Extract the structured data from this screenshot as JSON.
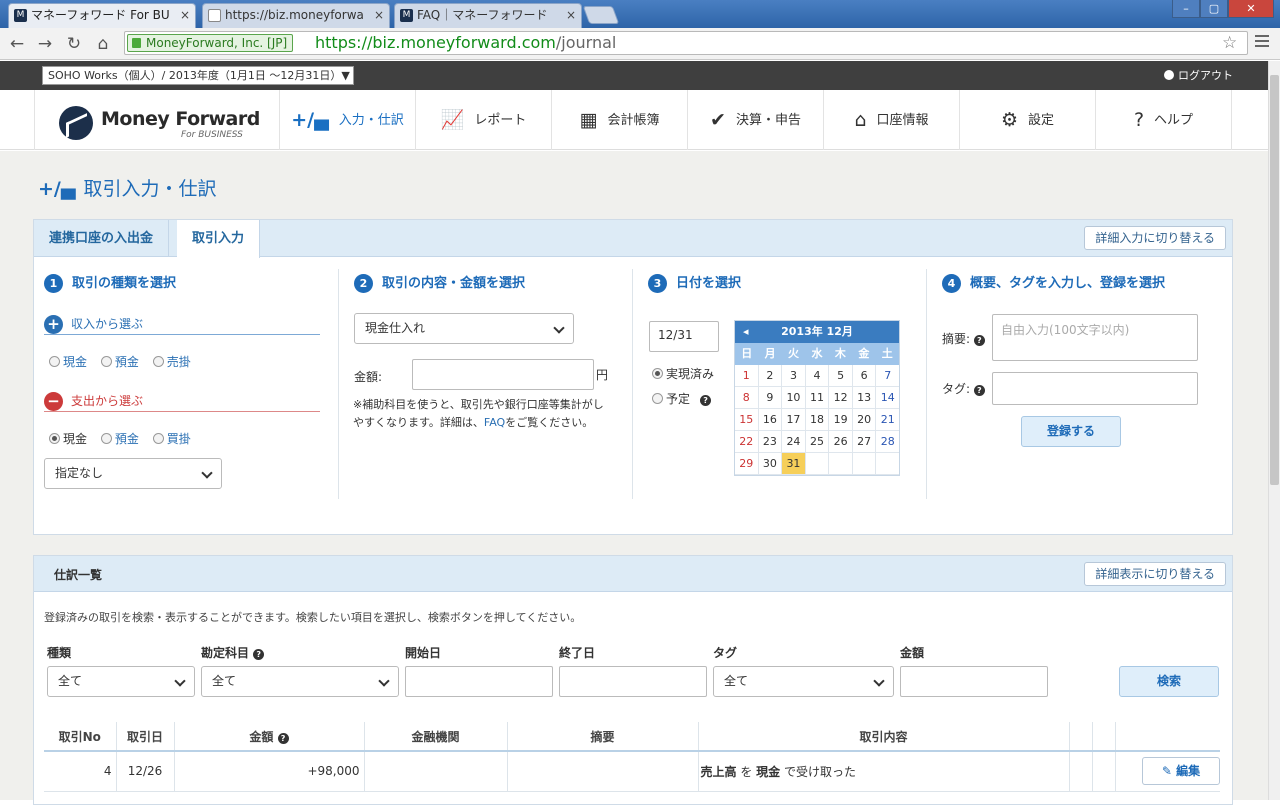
{
  "browser": {
    "tabs": [
      {
        "title": "マネーフォワード For BU",
        "close": "×",
        "favicon": "M"
      },
      {
        "title": "https://biz.moneyforwa",
        "close": "×",
        "favicon": ""
      },
      {
        "title": "FAQ｜マネーフォワード",
        "close": "×",
        "favicon": "M"
      }
    ],
    "window_buttons": [
      "–",
      "▢",
      "✕"
    ],
    "security_badge": "MoneyForward, Inc. [JP]",
    "url_scheme_host": "https://biz.moneyforward.com",
    "url_path": "/journal"
  },
  "topbar": {
    "office_select": "SOHO Works（個人）/  2013年度（1月1日 ～12月31日）▼",
    "logout": "ログアウト"
  },
  "logo": {
    "name": "Money Forward",
    "sub": "For BUSINESS"
  },
  "nav": [
    {
      "icon": "+/▄",
      "label": "入力・仕訳"
    },
    {
      "icon": "📈",
      "label": "レポート"
    },
    {
      "icon": "▦",
      "label": "会計帳簿"
    },
    {
      "icon": "✔",
      "label": "決算・申告"
    },
    {
      "icon": "⌂",
      "label": "口座情報"
    },
    {
      "icon": "⚙",
      "label": "設定"
    },
    {
      "icon": "?",
      "label": "ヘルプ"
    }
  ],
  "page": {
    "title_icon": "+/▄",
    "title": "取引入力・仕訳"
  },
  "entry": {
    "tabs": [
      "連携口座の入出金",
      "取引入力"
    ],
    "switch_label": "詳細入力に切り替える",
    "step1": {
      "num": "1",
      "title": "取引の種類を選択",
      "income_label": "収入から選ぶ",
      "income_options": [
        "現金",
        "預金",
        "売掛"
      ],
      "expense_label": "支出から選ぶ",
      "expense_options": [
        "現金",
        "預金",
        "買掛"
      ],
      "sub_select": "指定なし"
    },
    "step2": {
      "num": "2",
      "title": "取引の内容・金額を選択",
      "content_select": "現金仕入れ",
      "amount_label": "金額:",
      "amount_unit": "円",
      "note_text": "※補助科目を使うと、取引先や銀行口座等集計がしやすくなります。詳細は、",
      "note_link": "FAQ",
      "note_tail": "をご覧ください。"
    },
    "step3": {
      "num": "3",
      "title": "日付を選択",
      "date_value": "12/31",
      "status_options": [
        "実現済み",
        "予定"
      ],
      "calendar": {
        "prev": "◂",
        "month_label": "2013年 12月",
        "dow": [
          "日",
          "月",
          "火",
          "水",
          "木",
          "金",
          "土"
        ],
        "weeks": [
          [
            "1",
            "2",
            "3",
            "4",
            "5",
            "6",
            "7"
          ],
          [
            "8",
            "9",
            "10",
            "11",
            "12",
            "13",
            "14"
          ],
          [
            "15",
            "16",
            "17",
            "18",
            "19",
            "20",
            "21"
          ],
          [
            "22",
            "23",
            "24",
            "25",
            "26",
            "27",
            "28"
          ],
          [
            "29",
            "30",
            "31",
            "",
            "",
            "",
            ""
          ]
        ],
        "selected": "31"
      }
    },
    "step4": {
      "num": "4",
      "title": "概要、タグを入力し、登録を選択",
      "summary_label": "摘要:",
      "summary_placeholder": "自由入力(100文字以内)",
      "tag_label": "タグ:",
      "register": "登録する"
    }
  },
  "list": {
    "title": "仕訳一覧",
    "switch_label": "詳細表示に切り替える",
    "desc": "登録済みの取引を検索・表示することができます。検索したい項目を選択し、検索ボタンを押してください。",
    "filters": {
      "type_label": "種類",
      "type_value": "全て",
      "account_label": "勘定科目",
      "account_value": "全て",
      "start_label": "開始日",
      "end_label": "終了日",
      "tag_label": "タグ",
      "tag_value": "全て",
      "amount_label": "金額",
      "search": "検索"
    },
    "columns": [
      "取引No",
      "取引日",
      "金額",
      "金融機関",
      "摘要",
      "取引内容"
    ],
    "rows": [
      {
        "no": "4",
        "date": "12/26",
        "amount": "+98,000",
        "bank": "",
        "memo": "",
        "content_a": "売上高",
        "content_b": " を ",
        "content_c": "現金",
        "content_d": " で受け取った",
        "edit": "編集"
      }
    ]
  }
}
